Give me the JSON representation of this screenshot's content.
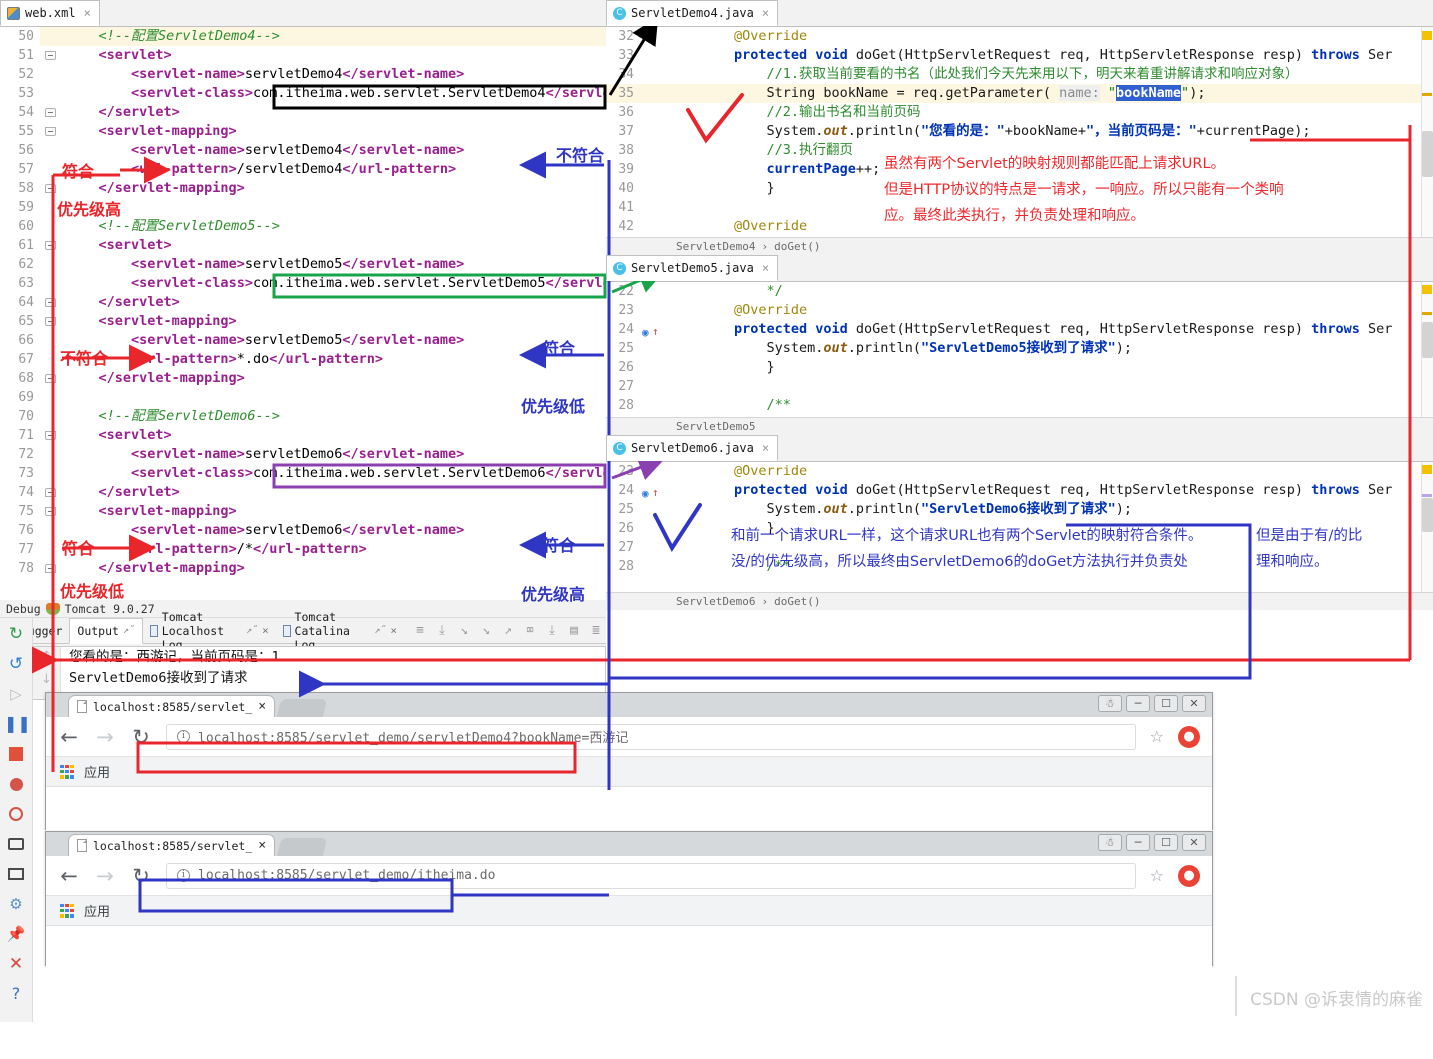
{
  "xml_editor": {
    "tab": {
      "label": "web.xml",
      "icon": "xml-file-icon",
      "close": "×"
    },
    "first_line": 50,
    "lines": [
      {
        "n": 50,
        "fold": "",
        "html": "comment",
        "text": "    <!--配置ServletDemo4-->"
      },
      {
        "n": 51,
        "fold": "down",
        "text": "    <servlet>"
      },
      {
        "n": 52,
        "fold": "",
        "text": "        <servlet-name>servletDemo4</servlet-name>"
      },
      {
        "n": 53,
        "fold": "",
        "text": "        <servlet-class>com.itheima.web.servlet.ServletDemo4</servlet-class>"
      },
      {
        "n": 54,
        "fold": "up",
        "text": "    </servlet>"
      },
      {
        "n": 55,
        "fold": "down",
        "text": "    <servlet-mapping>"
      },
      {
        "n": 56,
        "fold": "",
        "text": "        <servlet-name>servletDemo4</servlet-name>"
      },
      {
        "n": 57,
        "fold": "",
        "text": "        <url-pattern>/servletDemo4</url-pattern>"
      },
      {
        "n": 58,
        "fold": "up",
        "text": "    </servlet-mapping>"
      },
      {
        "n": 59,
        "fold": "",
        "text": ""
      },
      {
        "n": 60,
        "fold": "",
        "text": "    <!--配置ServletDemo5-->"
      },
      {
        "n": 61,
        "fold": "down",
        "text": "    <servlet>"
      },
      {
        "n": 62,
        "fold": "",
        "text": "        <servlet-name>servletDemo5</servlet-name>"
      },
      {
        "n": 63,
        "fold": "",
        "text": "        <servlet-class>com.itheima.web.servlet.ServletDemo5</servlet-class>"
      },
      {
        "n": 64,
        "fold": "up",
        "text": "    </servlet>"
      },
      {
        "n": 65,
        "fold": "down",
        "text": "    <servlet-mapping>"
      },
      {
        "n": 66,
        "fold": "",
        "text": "        <servlet-name>servletDemo5</servlet-name>"
      },
      {
        "n": 67,
        "fold": "",
        "text": "        <url-pattern>*.do</url-pattern>"
      },
      {
        "n": 68,
        "fold": "up",
        "text": "    </servlet-mapping>"
      },
      {
        "n": 69,
        "fold": "",
        "text": ""
      },
      {
        "n": 70,
        "fold": "",
        "text": "    <!--配置ServletDemo6-->"
      },
      {
        "n": 71,
        "fold": "down",
        "text": "    <servlet>"
      },
      {
        "n": 72,
        "fold": "",
        "text": "        <servlet-name>servletDemo6</servlet-name>"
      },
      {
        "n": 73,
        "fold": "",
        "text": "        <servlet-class>com.itheima.web.servlet.ServletDemo6</servlet-class>"
      },
      {
        "n": 74,
        "fold": "up",
        "text": "    </servlet>"
      },
      {
        "n": 75,
        "fold": "down",
        "text": "    <servlet-mapping>"
      },
      {
        "n": 76,
        "fold": "",
        "text": "        <servlet-name>servletDemo6</servlet-name>"
      },
      {
        "n": 77,
        "fold": "",
        "text": "        <url-pattern>/*</url-pattern>"
      },
      {
        "n": 78,
        "fold": "up",
        "text": "    </servlet-mapping>"
      }
    ]
  },
  "java4": {
    "tab": {
      "label": "ServletDemo4.java",
      "icon": "java-class-icon",
      "close": "×"
    },
    "breadcrumb": {
      "class": "ServletDemo4",
      "sep": "›",
      "method": "doGet()"
    },
    "lines": [
      {
        "n": 32,
        "seg": [
          {
            "c": "ann",
            "t": "@Override"
          }
        ]
      },
      {
        "n": 33,
        "seg": [
          {
            "c": "k",
            "t": "protected void "
          },
          {
            "c": "plain",
            "t": "doGet(HttpServletRequest req, HttpServletResponse resp) "
          },
          {
            "c": "k",
            "t": "throws "
          },
          {
            "c": "plain",
            "t": "Ser"
          }
        ]
      },
      {
        "n": 34,
        "seg": [
          {
            "c": "cm",
            "t": "    //1.获取当前要看的书名（此处我们今天先来用以下，明天来着重讲解请求和响应对象）"
          }
        ]
      },
      {
        "n": 35,
        "hl": true,
        "seg": [
          {
            "c": "plain",
            "t": "    String bookName = req.getParameter( "
          },
          {
            "c": "pname",
            "t": "name:"
          },
          {
            "c": "st",
            "t": " \""
          },
          {
            "c": "sel",
            "t": "bookName"
          },
          {
            "c": "st",
            "t": "\""
          },
          {
            "c": "plain",
            "t": ");"
          }
        ]
      },
      {
        "n": 36,
        "seg": [
          {
            "c": "cm",
            "t": "    //2.输出书名和当前页码"
          }
        ]
      },
      {
        "n": 37,
        "seg": [
          {
            "c": "plain",
            "t": "    System."
          },
          {
            "c": "fld",
            "t": "out"
          },
          {
            "c": "plain",
            "t": ".println("
          },
          {
            "c": "stb",
            "t": "\"您看的是：\""
          },
          {
            "c": "plain",
            "t": "+bookName+"
          },
          {
            "c": "stb",
            "t": "\"，当前页码是：\""
          },
          {
            "c": "plain",
            "t": "+currentPage);"
          }
        ]
      },
      {
        "n": 38,
        "seg": [
          {
            "c": "cm",
            "t": "    //3.执行翻页"
          }
        ]
      },
      {
        "n": 39,
        "seg": [
          {
            "c": "k",
            "t": "    currentPage"
          },
          {
            "c": "plain",
            "t": "++;"
          }
        ]
      },
      {
        "n": 40,
        "seg": [
          {
            "c": "plain",
            "t": "    }"
          }
        ]
      },
      {
        "n": 41,
        "seg": [
          {
            "c": "plain",
            "t": ""
          }
        ]
      },
      {
        "n": 42,
        "seg": [
          {
            "c": "ann",
            "t": "@Override"
          }
        ]
      }
    ],
    "annotation_red": [
      "虽然有两个Servlet的映射规则都能匹配上请求URL。",
      "但是HTTP协议的特点是一请求，一响应。所以只能有一个类响",
      "应。最终此类执行，并负责处理和响应。"
    ]
  },
  "java5": {
    "tab": {
      "label": "ServletDemo5.java",
      "icon": "java-class-icon",
      "close": "×"
    },
    "breadcrumb": {
      "class": "ServletDemo5",
      "sep": "",
      "method": ""
    },
    "lines": [
      {
        "n": 22,
        "seg": [
          {
            "c": "cm",
            "t": "    */"
          }
        ]
      },
      {
        "n": 23,
        "seg": [
          {
            "c": "ann",
            "t": "@Override"
          }
        ]
      },
      {
        "n": 24,
        "marker": "override-arrow",
        "seg": [
          {
            "c": "k",
            "t": "protected void "
          },
          {
            "c": "plain",
            "t": "doGet(HttpServletRequest req, HttpServletResponse resp) "
          },
          {
            "c": "k",
            "t": "throws "
          },
          {
            "c": "plain",
            "t": "Ser"
          }
        ]
      },
      {
        "n": 25,
        "seg": [
          {
            "c": "plain",
            "t": "    System."
          },
          {
            "c": "fld",
            "t": "out"
          },
          {
            "c": "plain",
            "t": ".println("
          },
          {
            "c": "stb",
            "t": "\"ServletDemo5接收到了请求\""
          },
          {
            "c": "plain",
            "t": ");"
          }
        ]
      },
      {
        "n": 26,
        "seg": [
          {
            "c": "plain",
            "t": "    }"
          }
        ]
      },
      {
        "n": 27,
        "seg": [
          {
            "c": "plain",
            "t": ""
          }
        ]
      },
      {
        "n": 28,
        "seg": [
          {
            "c": "cm",
            "t": "    /**"
          }
        ]
      }
    ]
  },
  "java6": {
    "tab": {
      "label": "ServletDemo6.java",
      "icon": "java-class-icon",
      "close": "×"
    },
    "breadcrumb": {
      "class": "ServletDemo6",
      "sep": "›",
      "method": "doGet()"
    },
    "lines": [
      {
        "n": 23,
        "seg": [
          {
            "c": "ann",
            "t": "@Override"
          }
        ]
      },
      {
        "n": 24,
        "marker": "override-arrow",
        "seg": [
          {
            "c": "k",
            "t": "protected void "
          },
          {
            "c": "plain",
            "t": "doGet(HttpServletRequest req, HttpServletResponse resp) "
          },
          {
            "c": "k",
            "t": "throws "
          },
          {
            "c": "plain",
            "t": "Ser"
          }
        ]
      },
      {
        "n": 25,
        "seg": [
          {
            "c": "plain",
            "t": "    System."
          },
          {
            "c": "fld",
            "t": "out"
          },
          {
            "c": "plain",
            "t": ".println("
          },
          {
            "c": "stb",
            "t": "\"ServletDemo6接收到了请求\""
          },
          {
            "c": "plain",
            "t": ");"
          }
        ]
      },
      {
        "n": 26,
        "seg": [
          {
            "c": "plain",
            "t": "    }"
          }
        ]
      },
      {
        "n": 27,
        "seg": [
          {
            "c": "plain",
            "t": ""
          }
        ]
      },
      {
        "n": 28,
        "seg": [
          {
            "c": "cm",
            "t": "    /**"
          }
        ]
      }
    ],
    "annotation_blue": [
      "和前一个请求URL一样，这个请求URL也有两个Servlet的映射符合条件。",
      "没/的优先级高，所以最终由ServletDemo6的doGet方法执行并负责处"
    ],
    "annotation_blue_right": [
      "但是由于有/的比",
      "理和响应。"
    ]
  },
  "debug": {
    "title_label": "Debug",
    "title_icon": "tomcat-icon",
    "config_name": "Tomcat 9.0.27",
    "tabs": [
      {
        "label": "Debugger",
        "icon": "",
        "pin": "",
        "close": "",
        "active": false
      },
      {
        "label": "Output",
        "icon": "",
        "pin": "↗˝",
        "close": "",
        "active": true
      },
      {
        "label": "Tomcat Localhost Log",
        "icon": "log-icon",
        "pin": "↗˝",
        "close": "×",
        "active": false
      },
      {
        "label": "Tomcat Catalina Log",
        "icon": "log-icon",
        "pin": "↗˝",
        "close": "×",
        "active": false
      }
    ],
    "toolbar_icons": [
      "soft-wrap-icon",
      "scroll-to-end-icon",
      "scroll-down-icon",
      "step-down-icon",
      "step-up-icon",
      "clear-all-icon",
      "print-icon",
      "table-icon",
      "settings-list-icon"
    ],
    "side_icons": [
      "rerun-icon",
      "restart-icon",
      "resume-icon",
      "pause-icon",
      "stop-icon",
      "breakpoints-icon",
      "mute-breakpoints-icon",
      "camera-icon",
      "layout-icon",
      "settings-icon",
      "pin-icon",
      "close-icon",
      "help-icon"
    ],
    "console_gutter_icons": [
      "scroll-up-icon",
      "scroll-down-icon",
      "soft-wrap-icon",
      "use-console-icon",
      "print-icon",
      "trash-icon"
    ],
    "console_lines": [
      "您看的是：西游记，当前页码是：1",
      "ServletDemo6接收到了请求"
    ]
  },
  "browsers": [
    {
      "tab_title": "localhost:8585/servlet_",
      "tab_close": "×",
      "back": "←",
      "forward": "→",
      "reload": "↻",
      "url": "localhost:8585/servlet_demo/servletDemo4?bookName=西游记",
      "url_info_icon": "info-icon",
      "star": "☆",
      "profile_icon": "profile-avatar",
      "bookmarks_label": "应用",
      "apps_icon": "apps-grid-icon",
      "window_buttons": [
        "profile-icon",
        "minimize-icon",
        "maximize-icon",
        "close-icon"
      ],
      "highlight_color": "#e8262b"
    },
    {
      "tab_title": "localhost:8585/servlet_",
      "tab_close": "×",
      "back": "←",
      "forward": "→",
      "reload": "↻",
      "url": "localhost:8585/servlet_demo/itheima.do",
      "url_info_icon": "info-icon",
      "star": "☆",
      "profile_icon": "profile-avatar",
      "bookmarks_label": "应用",
      "apps_icon": "apps-grid-icon",
      "window_buttons": [
        "profile-icon",
        "minimize-icon",
        "maximize-icon",
        "close-icon"
      ],
      "highlight_color": "#2f36c4"
    }
  ],
  "annotations": {
    "red": {
      "color": "#e8262b",
      "match_1": "符合",
      "priority_high": "优先级高",
      "nomatch_2": "不符合",
      "match_3": "符合",
      "priority_low": "优先级低"
    },
    "blue": {
      "color": "#2f36c4",
      "nomatch_1": "不符合",
      "match_2": "符合",
      "priority_low": "优先级低",
      "match_3": "符合",
      "priority_high": "优先级高"
    },
    "boxes": {
      "black": "#000000",
      "green": "#1aa44a",
      "purple": "#8c3fb0"
    }
  },
  "watermark": {
    "text": "CSDN @诉衷情的麻雀"
  }
}
